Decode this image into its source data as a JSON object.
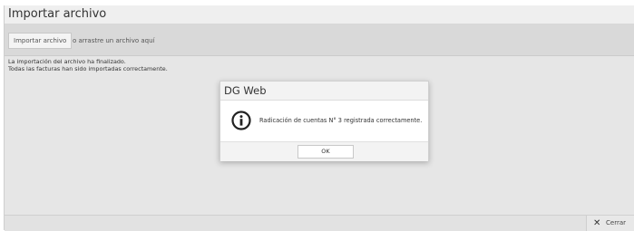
{
  "window": {
    "title": "Importar archivo",
    "overflow_glyph": "⋮"
  },
  "toolbar": {
    "upload_label": "Importar archivo",
    "drop_hint": "o arrastre un archivo aquí"
  },
  "messages": [
    "La importación del archivo ha finalizado.",
    "Todas las facturas han sido importadas correctamente."
  ],
  "footer": {
    "close_label": "Cerrar",
    "close_glyph": "✕"
  },
  "dialog": {
    "title": "DG Web",
    "message": "Radicación de cuentas N° 3 registrada correctamente.",
    "ok_label": "OK",
    "icon": "info-icon"
  }
}
